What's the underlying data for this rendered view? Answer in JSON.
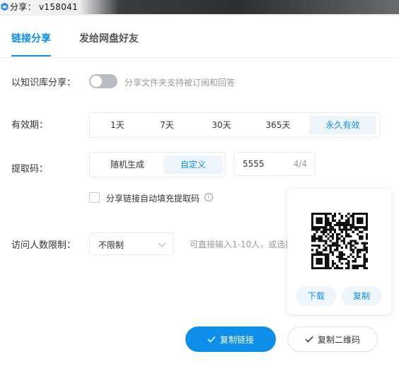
{
  "window": {
    "title": "分享： v158041"
  },
  "tabs": [
    {
      "label": "链接分享",
      "active": true
    },
    {
      "label": "发给网盘好友",
      "active": false
    }
  ],
  "knowledge_share": {
    "label": "以知识库分享：",
    "enabled": false,
    "hint": "分享文件夹支持被订阅和回答"
  },
  "validity": {
    "label": "有效期：",
    "options": [
      "1天",
      "7天",
      "30天",
      "365天",
      "永久有效"
    ],
    "selected": "永久有效"
  },
  "extract_code": {
    "label": "提取码：",
    "options": [
      "随机生成",
      "自定义"
    ],
    "selected": "自定义",
    "value": "5555",
    "counter": "4/4",
    "autofill_label": "分享链接自动填充提取码",
    "autofill_checked": false,
    "info_glyph": "i"
  },
  "visitor_limit": {
    "label": "访问人数限制：",
    "value": "不限制",
    "hint": "可直接输入1-10人，或选择"
  },
  "qr_card": {
    "download_label": "下载",
    "copy_label": "复制"
  },
  "actions": {
    "copy_link_label": "复制链接",
    "copy_qr_label": "复制二维码"
  },
  "colors": {
    "accent": "#0d8ee9",
    "accent_light": "#eef6fc"
  }
}
